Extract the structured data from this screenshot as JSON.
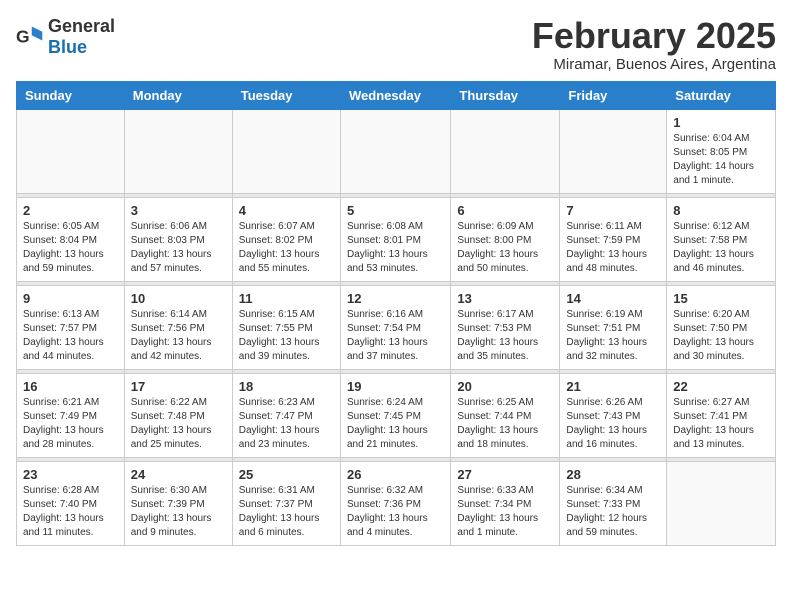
{
  "logo": {
    "general": "General",
    "blue": "Blue"
  },
  "title": {
    "month_year": "February 2025",
    "location": "Miramar, Buenos Aires, Argentina"
  },
  "headers": [
    "Sunday",
    "Monday",
    "Tuesday",
    "Wednesday",
    "Thursday",
    "Friday",
    "Saturday"
  ],
  "weeks": [
    [
      {
        "day": "",
        "info": ""
      },
      {
        "day": "",
        "info": ""
      },
      {
        "day": "",
        "info": ""
      },
      {
        "day": "",
        "info": ""
      },
      {
        "day": "",
        "info": ""
      },
      {
        "day": "",
        "info": ""
      },
      {
        "day": "1",
        "info": "Sunrise: 6:04 AM\nSunset: 8:05 PM\nDaylight: 14 hours\nand 1 minute."
      }
    ],
    [
      {
        "day": "2",
        "info": "Sunrise: 6:05 AM\nSunset: 8:04 PM\nDaylight: 13 hours\nand 59 minutes."
      },
      {
        "day": "3",
        "info": "Sunrise: 6:06 AM\nSunset: 8:03 PM\nDaylight: 13 hours\nand 57 minutes."
      },
      {
        "day": "4",
        "info": "Sunrise: 6:07 AM\nSunset: 8:02 PM\nDaylight: 13 hours\nand 55 minutes."
      },
      {
        "day": "5",
        "info": "Sunrise: 6:08 AM\nSunset: 8:01 PM\nDaylight: 13 hours\nand 53 minutes."
      },
      {
        "day": "6",
        "info": "Sunrise: 6:09 AM\nSunset: 8:00 PM\nDaylight: 13 hours\nand 50 minutes."
      },
      {
        "day": "7",
        "info": "Sunrise: 6:11 AM\nSunset: 7:59 PM\nDaylight: 13 hours\nand 48 minutes."
      },
      {
        "day": "8",
        "info": "Sunrise: 6:12 AM\nSunset: 7:58 PM\nDaylight: 13 hours\nand 46 minutes."
      }
    ],
    [
      {
        "day": "9",
        "info": "Sunrise: 6:13 AM\nSunset: 7:57 PM\nDaylight: 13 hours\nand 44 minutes."
      },
      {
        "day": "10",
        "info": "Sunrise: 6:14 AM\nSunset: 7:56 PM\nDaylight: 13 hours\nand 42 minutes."
      },
      {
        "day": "11",
        "info": "Sunrise: 6:15 AM\nSunset: 7:55 PM\nDaylight: 13 hours\nand 39 minutes."
      },
      {
        "day": "12",
        "info": "Sunrise: 6:16 AM\nSunset: 7:54 PM\nDaylight: 13 hours\nand 37 minutes."
      },
      {
        "day": "13",
        "info": "Sunrise: 6:17 AM\nSunset: 7:53 PM\nDaylight: 13 hours\nand 35 minutes."
      },
      {
        "day": "14",
        "info": "Sunrise: 6:19 AM\nSunset: 7:51 PM\nDaylight: 13 hours\nand 32 minutes."
      },
      {
        "day": "15",
        "info": "Sunrise: 6:20 AM\nSunset: 7:50 PM\nDaylight: 13 hours\nand 30 minutes."
      }
    ],
    [
      {
        "day": "16",
        "info": "Sunrise: 6:21 AM\nSunset: 7:49 PM\nDaylight: 13 hours\nand 28 minutes."
      },
      {
        "day": "17",
        "info": "Sunrise: 6:22 AM\nSunset: 7:48 PM\nDaylight: 13 hours\nand 25 minutes."
      },
      {
        "day": "18",
        "info": "Sunrise: 6:23 AM\nSunset: 7:47 PM\nDaylight: 13 hours\nand 23 minutes."
      },
      {
        "day": "19",
        "info": "Sunrise: 6:24 AM\nSunset: 7:45 PM\nDaylight: 13 hours\nand 21 minutes."
      },
      {
        "day": "20",
        "info": "Sunrise: 6:25 AM\nSunset: 7:44 PM\nDaylight: 13 hours\nand 18 minutes."
      },
      {
        "day": "21",
        "info": "Sunrise: 6:26 AM\nSunset: 7:43 PM\nDaylight: 13 hours\nand 16 minutes."
      },
      {
        "day": "22",
        "info": "Sunrise: 6:27 AM\nSunset: 7:41 PM\nDaylight: 13 hours\nand 13 minutes."
      }
    ],
    [
      {
        "day": "23",
        "info": "Sunrise: 6:28 AM\nSunset: 7:40 PM\nDaylight: 13 hours\nand 11 minutes."
      },
      {
        "day": "24",
        "info": "Sunrise: 6:30 AM\nSunset: 7:39 PM\nDaylight: 13 hours\nand 9 minutes."
      },
      {
        "day": "25",
        "info": "Sunrise: 6:31 AM\nSunset: 7:37 PM\nDaylight: 13 hours\nand 6 minutes."
      },
      {
        "day": "26",
        "info": "Sunrise: 6:32 AM\nSunset: 7:36 PM\nDaylight: 13 hours\nand 4 minutes."
      },
      {
        "day": "27",
        "info": "Sunrise: 6:33 AM\nSunset: 7:34 PM\nDaylight: 13 hours\nand 1 minute."
      },
      {
        "day": "28",
        "info": "Sunrise: 6:34 AM\nSunset: 7:33 PM\nDaylight: 12 hours\nand 59 minutes."
      },
      {
        "day": "",
        "info": ""
      }
    ]
  ]
}
